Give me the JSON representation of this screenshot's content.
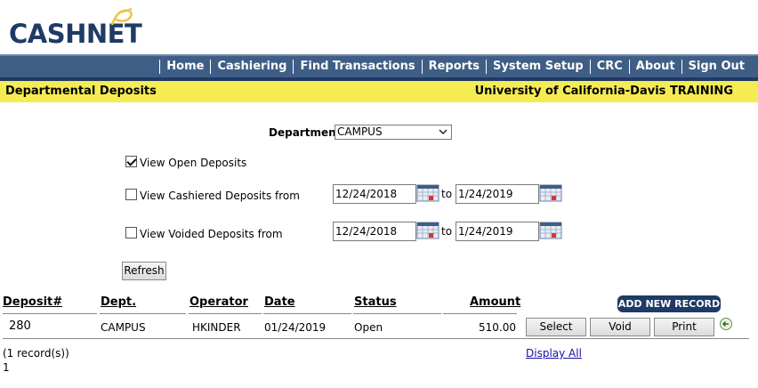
{
  "brand": {
    "name": "CASHNET",
    "reg": "®"
  },
  "nav": {
    "items": [
      "Home",
      "Cashiering",
      "Find Transactions",
      "Reports",
      "System Setup",
      "CRC",
      "About",
      "Sign Out"
    ]
  },
  "subheader": {
    "page_title": "Departmental Deposits",
    "org": "University of California-Davis TRAINING"
  },
  "form": {
    "department_label": "Department",
    "department_value": "CAMPUS",
    "view_open_label": "View Open Deposits",
    "view_open_checked": true,
    "view_cashiered_label": "View Cashiered Deposits from",
    "view_cashiered_checked": false,
    "cashiered_from": "12/24/2018",
    "cashiered_to": "1/24/2019",
    "view_voided_label": "View Voided Deposits from",
    "view_voided_checked": false,
    "voided_from": "12/24/2018",
    "voided_to": "1/24/2019",
    "to_label": "to",
    "refresh_label": "Refresh"
  },
  "table": {
    "headers": {
      "deposit": "Deposit#",
      "dept": "Dept.",
      "operator": "Operator",
      "date": "Date",
      "status": "Status",
      "amount": "Amount"
    },
    "add_new_label": "ADD NEW RECORD",
    "rows": [
      {
        "deposit": "280",
        "dept": "CAMPUS",
        "operator": "HKINDER",
        "date": "01/24/2019",
        "status": "Open",
        "amount": "510.00",
        "actions": [
          "Select",
          "Void",
          "Print"
        ]
      }
    ],
    "record_count": "(1 record(s))",
    "page_number": "1",
    "display_all_label": "Display All"
  },
  "icons": {
    "calendar": "calendar-icon",
    "dropdown": "chevron-down-icon",
    "row_action": "arrow-left-circle-icon"
  },
  "colors": {
    "nav_bg": "#3f5e86",
    "nav_border": "#1f3a66",
    "subheader_bg": "#f5ec53",
    "brand": "#1f3a66",
    "add_button_bg": "#1f3a66"
  }
}
